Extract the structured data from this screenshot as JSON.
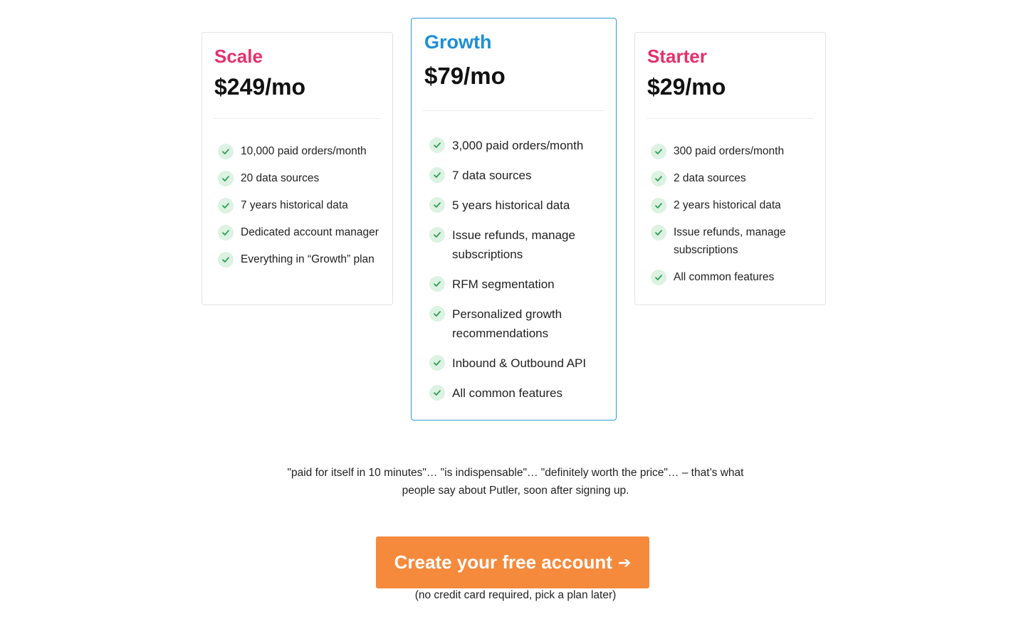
{
  "plans": [
    {
      "name": "Scale",
      "price": "$249/mo",
      "features": [
        "10,000 paid orders/month",
        "20 data sources",
        "7 years historical data",
        "Dedicated account manager",
        "Everything in “Growth” plan"
      ]
    },
    {
      "name": "Growth",
      "price": "$79/mo",
      "features": [
        "3,000 paid orders/month",
        "7 data sources",
        "5 years historical data",
        "Issue refunds, manage subscriptions",
        "RFM segmentation",
        "Personalized growth recommendations",
        "Inbound & Outbound API",
        "All common features"
      ]
    },
    {
      "name": "Starter",
      "price": "$29/mo",
      "features": [
        "300 paid orders/month",
        "2 data sources",
        "2 years historical data",
        "Issue refunds, manage subscriptions",
        "All common features"
      ]
    }
  ],
  "quote": "\"paid for itself in 10 minutes\"… \"is indispensable\"… \"definitely worth the price\"… – that’s what people say about Putler, soon after signing up.",
  "cta": {
    "label": "Create your free account",
    "arrow": "➔",
    "note": "(no credit card required, pick a plan later)"
  },
  "colors": {
    "scale_name": "#e72f6a",
    "growth_name": "#1d8fd6",
    "starter_name": "#e72f6a",
    "growth_border": "#2a9bd8",
    "check_bg": "#dcf2e3",
    "check_mark": "#2f9e55",
    "cta_bg": "#f58a3c"
  },
  "icons": {
    "feature_check": "check-icon",
    "cta_arrow": "arrow-right-icon"
  }
}
